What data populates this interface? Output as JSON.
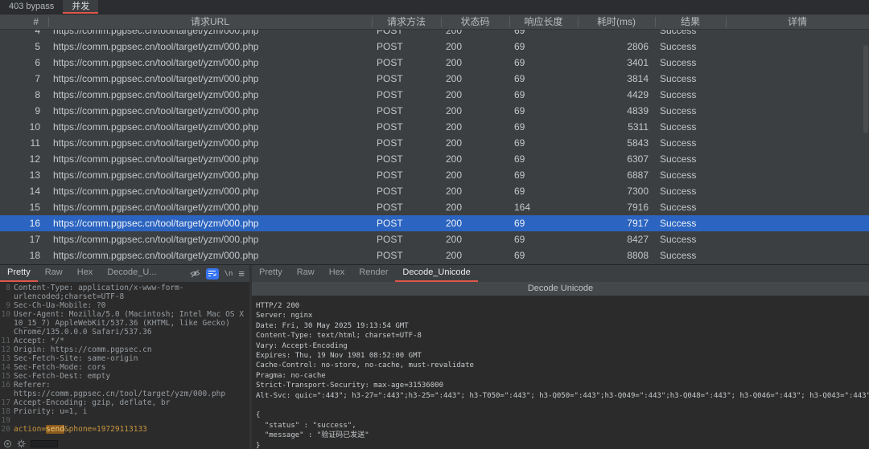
{
  "colors": {
    "accent": "#e0564a",
    "selection": "#2b64c1",
    "payload_text": "#c9953f",
    "payload_background": "#8a5a1c"
  },
  "window": {
    "tabs": [
      {
        "label": "403 bypass",
        "slug": "403-bypass",
        "active": false
      },
      {
        "label": "并发",
        "slug": "concurrency",
        "active": true
      }
    ]
  },
  "table": {
    "columns": [
      {
        "key": "num",
        "label": "#"
      },
      {
        "key": "url",
        "label": "请求URL"
      },
      {
        "key": "method",
        "label": "请求方法"
      },
      {
        "key": "status",
        "label": "状态码"
      },
      {
        "key": "length",
        "label": "响应长度"
      },
      {
        "key": "time",
        "label": "耗时(ms)"
      },
      {
        "key": "result",
        "label": "结果"
      },
      {
        "key": "details",
        "label": "详情"
      }
    ],
    "overflow_indicator": "...",
    "rows": [
      {
        "num": "4",
        "url": "https://comm.pgpsec.cn/tool/target/yzm/000.php",
        "method": "POST",
        "status": "200",
        "length": "69",
        "time": "",
        "result": "Success",
        "partial": true
      },
      {
        "num": "5",
        "url": "https://comm.pgpsec.cn/tool/target/yzm/000.php",
        "method": "POST",
        "status": "200",
        "length": "69",
        "time": "2806",
        "result": "Success"
      },
      {
        "num": "6",
        "url": "https://comm.pgpsec.cn/tool/target/yzm/000.php",
        "method": "POST",
        "status": "200",
        "length": "69",
        "time": "3401",
        "result": "Success"
      },
      {
        "num": "7",
        "url": "https://comm.pgpsec.cn/tool/target/yzm/000.php",
        "method": "POST",
        "status": "200",
        "length": "69",
        "time": "3814",
        "result": "Success"
      },
      {
        "num": "8",
        "url": "https://comm.pgpsec.cn/tool/target/yzm/000.php",
        "method": "POST",
        "status": "200",
        "length": "69",
        "time": "4429",
        "result": "Success"
      },
      {
        "num": "9",
        "url": "https://comm.pgpsec.cn/tool/target/yzm/000.php",
        "method": "POST",
        "status": "200",
        "length": "69",
        "time": "4839",
        "result": "Success"
      },
      {
        "num": "10",
        "url": "https://comm.pgpsec.cn/tool/target/yzm/000.php",
        "method": "POST",
        "status": "200",
        "length": "69",
        "time": "5311",
        "result": "Success"
      },
      {
        "num": "11",
        "url": "https://comm.pgpsec.cn/tool/target/yzm/000.php",
        "method": "POST",
        "status": "200",
        "length": "69",
        "time": "5843",
        "result": "Success"
      },
      {
        "num": "12",
        "url": "https://comm.pgpsec.cn/tool/target/yzm/000.php",
        "method": "POST",
        "status": "200",
        "length": "69",
        "time": "6307",
        "result": "Success"
      },
      {
        "num": "13",
        "url": "https://comm.pgpsec.cn/tool/target/yzm/000.php",
        "method": "POST",
        "status": "200",
        "length": "69",
        "time": "6887",
        "result": "Success"
      },
      {
        "num": "14",
        "url": "https://comm.pgpsec.cn/tool/target/yzm/000.php",
        "method": "POST",
        "status": "200",
        "length": "69",
        "time": "7300",
        "result": "Success"
      },
      {
        "num": "15",
        "url": "https://comm.pgpsec.cn/tool/target/yzm/000.php",
        "method": "POST",
        "status": "200",
        "length": "164",
        "time": "7916",
        "result": "Success"
      },
      {
        "num": "16",
        "url": "https://comm.pgpsec.cn/tool/target/yzm/000.php",
        "method": "POST",
        "status": "200",
        "length": "69",
        "time": "7917",
        "result": "Success",
        "selected": true
      },
      {
        "num": "17",
        "url": "https://comm.pgpsec.cn/tool/target/yzm/000.php",
        "method": "POST",
        "status": "200",
        "length": "69",
        "time": "8427",
        "result": "Success"
      },
      {
        "num": "18",
        "url": "https://comm.pgpsec.cn/tool/target/yzm/000.php",
        "method": "POST",
        "status": "200",
        "length": "69",
        "time": "8808",
        "result": "Success"
      }
    ]
  },
  "request_panel": {
    "tabs": [
      {
        "label": "Pretty",
        "active": true
      },
      {
        "label": "Raw",
        "active": false
      },
      {
        "label": "Hex",
        "active": false
      },
      {
        "label": "Decode_U...",
        "active": false
      }
    ],
    "lines": [
      {
        "no": "8",
        "text": "Content-Type: application/x-www-form-urlencoded;charset=UTF-8"
      },
      {
        "no": "9",
        "text": "Sec-Ch-Ua-Mobile: ?0"
      },
      {
        "no": "10",
        "text": "User-Agent: Mozilla/5.0 (Macintosh; Intel Mac OS X 10_15_7) AppleWebKit/537.36 (KHTML, like Gecko) Chrome/135.0.0.0 Safari/537.36"
      },
      {
        "no": "11",
        "text": "Accept: */*"
      },
      {
        "no": "12",
        "text": "Origin: https://comm.pgpsec.cn"
      },
      {
        "no": "13",
        "text": "Sec-Fetch-Site: same-origin"
      },
      {
        "no": "14",
        "text": "Sec-Fetch-Mode: cors"
      },
      {
        "no": "15",
        "text": "Sec-Fetch-Dest: empty"
      },
      {
        "no": "16",
        "text": "Referer: https://comm.pgpsec.cn/tool/target/yzm/000.php"
      },
      {
        "no": "17",
        "text": "Accept-Encoding: gzip, deflate, br"
      },
      {
        "no": "18",
        "text": "Priority: u=1, i"
      },
      {
        "no": "19",
        "text": ""
      },
      {
        "no": "20",
        "payload": {
          "pre": "action=",
          "value": "send",
          "post": "&phone=19729113133"
        }
      }
    ]
  },
  "response_panel": {
    "tabs": [
      {
        "label": "Pretty",
        "active": false
      },
      {
        "label": "Raw",
        "active": false
      },
      {
        "label": "Hex",
        "active": false
      },
      {
        "label": "Render",
        "active": false
      },
      {
        "label": "Decode_Unicode",
        "active": true
      }
    ],
    "header": "Decode Unicode",
    "lines": [
      "HTTP/2 200",
      "Server: nginx",
      "Date: Fri, 30 May 2025 19:13:54 GMT",
      "Content-Type: text/html; charset=UTF-8",
      "Vary: Accept-Encoding",
      "Expires: Thu, 19 Nov 1981 08:52:00 GMT",
      "Cache-Control: no-store, no-cache, must-revalidate",
      "Pragma: no-cache",
      "Strict-Transport-Security: max-age=31536000",
      "Alt-Svc: quic=\":443\"; h3-27=\":443\";h3-25=\":443\"; h3-T050=\":443\"; h3-Q050=\":443\";h3-Q049=\":443\";h3-Q048=\":443\"; h3-Q046=\":443\"; h3-Q043=\":443\"",
      "",
      "{",
      "  \"status\" : \"success\",",
      "  \"message\" : \"验证码已发送\"",
      "}"
    ]
  }
}
